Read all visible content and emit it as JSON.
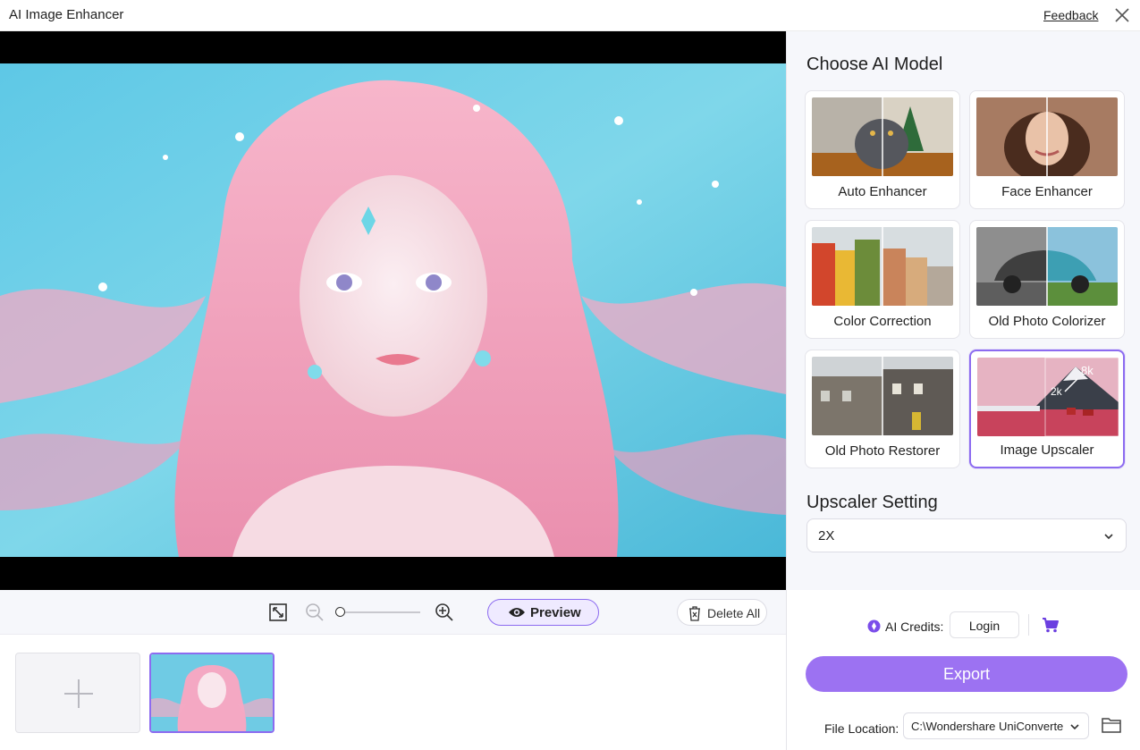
{
  "app": {
    "title": "AI Image Enhancer",
    "feedback_label": "Feedback",
    "close_icon": "close-icon"
  },
  "models_section": {
    "title": "Choose AI Model",
    "models": [
      {
        "label": "Auto Enhancer",
        "icon": "cat-photo-thumbnail",
        "selected": false
      },
      {
        "label": "Face Enhancer",
        "icon": "portrait-photo-thumbnail",
        "selected": false
      },
      {
        "label": "Color Correction",
        "icon": "houses-photo-thumbnail",
        "selected": false
      },
      {
        "label": "Old Photo Colorizer",
        "icon": "car-photo-thumbnail",
        "selected": false
      },
      {
        "label": "Old Photo Restorer",
        "icon": "buildings-photo-thumbnail",
        "selected": false
      },
      {
        "label": "Image Upscaler",
        "icon": "landscape-photo-thumbnail",
        "selected": true,
        "badges": [
          "8k",
          "2k"
        ]
      }
    ]
  },
  "upscaler": {
    "title": "Upscaler Setting",
    "value": "2X"
  },
  "toolbar": {
    "preview_label": "Preview",
    "delete_all_label": "Delete All"
  },
  "account": {
    "credits_label": "AI Credits:",
    "login_label": "Login"
  },
  "export": {
    "label": "Export"
  },
  "file_location": {
    "label": "File Location:",
    "value": "C:\\Wondershare UniConverte"
  },
  "colors": {
    "accent": "#8c6bf0",
    "export_bg": "#9c72f2"
  }
}
